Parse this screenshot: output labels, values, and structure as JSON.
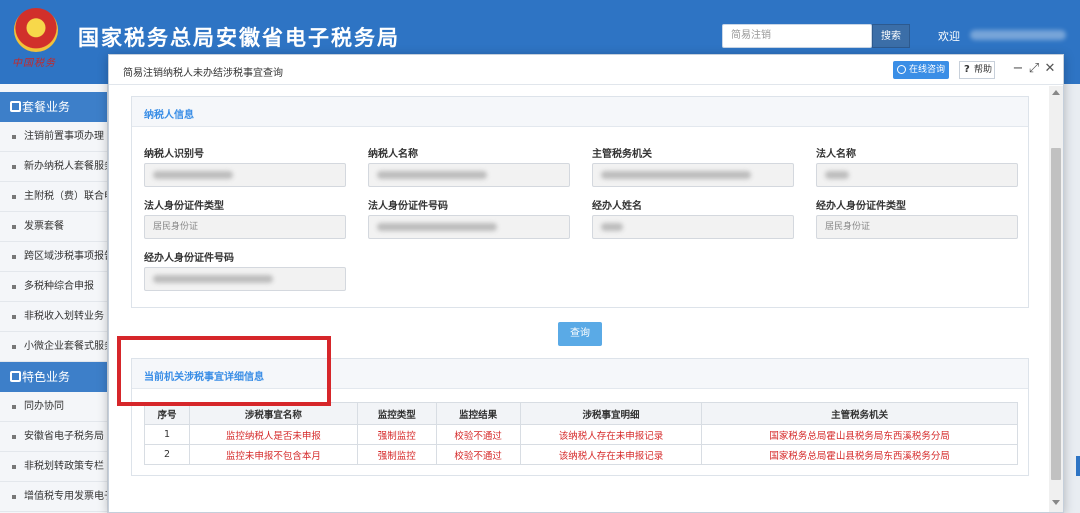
{
  "header": {
    "emblem_script": "中国税务",
    "site_title": "国家税务总局安徽省电子税务局",
    "search_placeholder": "简易注销",
    "search_button": "搜索",
    "welcome": "欢迎"
  },
  "sidebar": {
    "section1": "套餐业务",
    "items1": [
      "注销前置事项办理",
      "新办纳税人套餐服务",
      "主附税（费）联合申报",
      "发票套餐",
      "跨区域涉税事项报告",
      "多税种综合申报",
      "非税收入划转业务",
      "小微企业套餐式服务"
    ],
    "section2": "特色业务",
    "items2": [
      "同办协同",
      "安徽省电子税务局",
      "非税划转政策专栏",
      "增值税专用发票电子化"
    ]
  },
  "modal": {
    "title": "简易注销纳税人未办结涉税事宜查询",
    "online_consult": "在线咨询",
    "help": "帮助",
    "minimize_glyph": "−",
    "maximize_glyph": "⤢",
    "close_glyph": "✕"
  },
  "taxpayer_panel": {
    "heading": "纳税人信息",
    "fields": [
      {
        "label": "纳税人识别号",
        "value": ""
      },
      {
        "label": "纳税人名称",
        "value": ""
      },
      {
        "label": "主管税务机关",
        "value": ""
      },
      {
        "label": "法人名称",
        "value": ""
      },
      {
        "label": "法人身份证件类型",
        "value": "居民身份证"
      },
      {
        "label": "法人身份证件号码",
        "value": ""
      },
      {
        "label": "经办人姓名",
        "value": ""
      },
      {
        "label": "经办人身份证件类型",
        "value": "居民身份证"
      },
      {
        "label": "经办人身份证件号码",
        "value": ""
      }
    ]
  },
  "query_button": "查询",
  "detail_panel": {
    "heading": "当前机关涉税事宜详细信息",
    "columns": [
      "序号",
      "涉税事宜名称",
      "监控类型",
      "监控结果",
      "涉税事宜明细",
      "主管税务机关"
    ],
    "rows": [
      [
        "1",
        "监控纳税人是否未申报",
        "强制监控",
        "校验不通过",
        "该纳税人存在未申报记录",
        "国家税务总局霍山县税务局东西溪税务分局"
      ],
      [
        "2",
        "监控未申报不包含本月",
        "强制监控",
        "校验不通过",
        "该纳税人存在未申报记录",
        "国家税务总局霍山县税务局东西溪税务分局"
      ]
    ]
  },
  "colors": {
    "header_blue": "#2e74c4",
    "accent_blue": "#3a8ee6",
    "alert_red": "#d52a2a",
    "highlight_red": "#d6262a"
  }
}
